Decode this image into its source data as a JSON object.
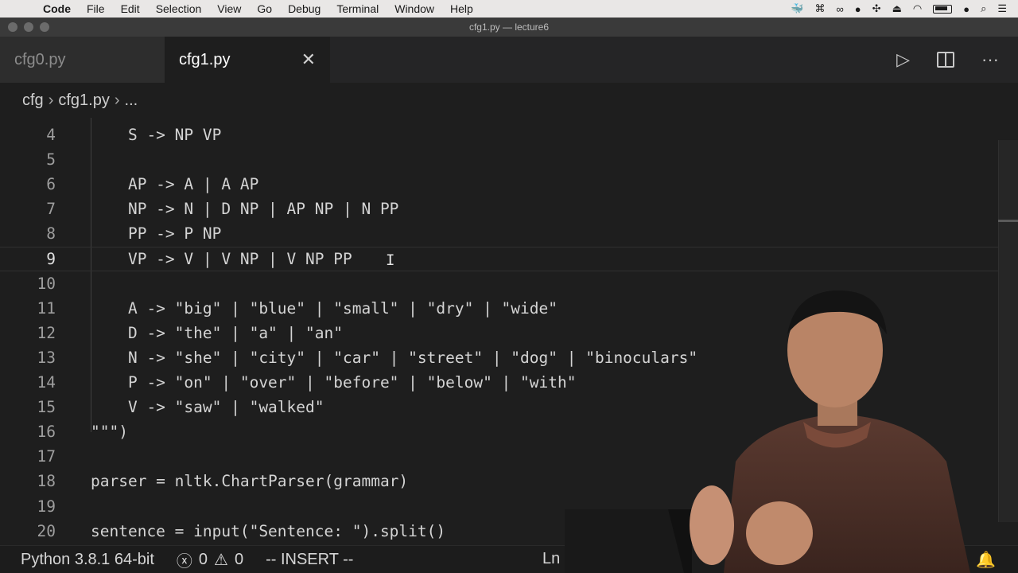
{
  "menubar": {
    "apple_icon": "apple-icon",
    "items": [
      "Code",
      "File",
      "Edit",
      "Selection",
      "View",
      "Go",
      "Debug",
      "Terminal",
      "Window",
      "Help"
    ]
  },
  "window": {
    "title": "cfg1.py — lecture6"
  },
  "tabs": [
    {
      "label": "cfg0.py",
      "active": false
    },
    {
      "label": "cfg1.py",
      "active": true,
      "close": "✕"
    }
  ],
  "breadcrumb": {
    "folder": "cfg",
    "file": "cfg1.py",
    "more": "..."
  },
  "editor": {
    "lines": [
      {
        "num": "4",
        "text": "    S -> NP VP"
      },
      {
        "num": "5",
        "text": ""
      },
      {
        "num": "6",
        "text": "    AP -> A | A AP"
      },
      {
        "num": "7",
        "text": "    NP -> N | D NP | AP NP | N PP"
      },
      {
        "num": "8",
        "text": "    PP -> P NP"
      },
      {
        "num": "9",
        "text": "    VP -> V | V NP | V NP PP"
      },
      {
        "num": "10",
        "text": ""
      },
      {
        "num": "11",
        "text": "    A -> \"big\" | \"blue\" | \"small\" | \"dry\" | \"wide\""
      },
      {
        "num": "12",
        "text": "    D -> \"the\" | \"a\" | \"an\""
      },
      {
        "num": "13",
        "text": "    N -> \"she\" | \"city\" | \"car\" | \"street\" | \"dog\" | \"binoculars\""
      },
      {
        "num": "14",
        "text": "    P -> \"on\" | \"over\" | \"before\" | \"below\" | \"with\""
      },
      {
        "num": "15",
        "text": "    V -> \"saw\" | \"walked\""
      },
      {
        "num": "16",
        "text": "\"\"\")"
      },
      {
        "num": "17",
        "text": ""
      },
      {
        "num": "18",
        "text": "parser = nltk.ChartParser(grammar)"
      },
      {
        "num": "19",
        "text": ""
      },
      {
        "num": "20",
        "text": "sentence = input(\"Sentence: \").split()"
      }
    ],
    "current_line": "9"
  },
  "statusbar": {
    "python": "Python 3.8.1 64-bit",
    "errors": "0",
    "warnings": "0",
    "mode": "-- INSERT --",
    "position": "Ln 9, C"
  },
  "colors": {
    "editor_bg": "#1e1e1e",
    "menubar_bg": "#e9e7e6",
    "text": "#d4d4d4"
  }
}
